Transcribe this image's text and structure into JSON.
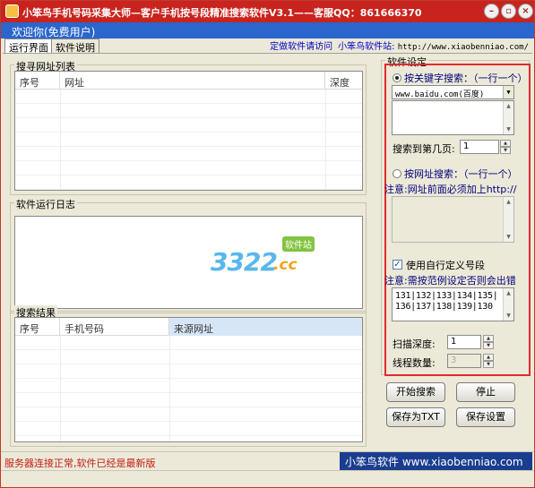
{
  "window": {
    "title": "小笨鸟手机号码采集大师—客户手机按号段精准搜索软件V3.1——客服QQ：861666370",
    "controls": [
      "minimize-icon",
      "restore-icon",
      "close-icon"
    ],
    "accent": "#c9231d"
  },
  "welcome": {
    "text": "欢迎你(免费用户)"
  },
  "tabs": [
    {
      "label": "运行界面",
      "active": true
    },
    {
      "label": "软件说明",
      "active": false
    }
  ],
  "links": {
    "custom": "定做软件请访问",
    "site_label": "小笨鸟软件站:",
    "site_url": "http://www.xiaobenniao.com/"
  },
  "url_list": {
    "title": "搜寻网址列表",
    "columns": [
      "序号",
      "网址",
      "深度"
    ]
  },
  "log": {
    "title": "软件运行日志",
    "watermark": {
      "number": "3322",
      "suffix": ".cc",
      "tag": "软件站"
    }
  },
  "results": {
    "title": "搜索结果",
    "columns": [
      "序号",
      "手机号码",
      "来源网址"
    ]
  },
  "settings": {
    "title": "软件设定",
    "keyword_radio": {
      "label": "按关键字搜索：（一行一个）",
      "selected": true
    },
    "engine_select": "www.baidu.com(百度)",
    "keywords": "",
    "pages_label": "搜索到第几页:",
    "pages_value": "1",
    "url_radio": {
      "label": "按网址搜索：（一行一个）",
      "selected": false
    },
    "url_note": "注意:网址前面必须加上http://",
    "custom_segment": {
      "label": "使用自行定义号段",
      "checked": true
    },
    "segment_note": "注意:需按范例设定否则会出错",
    "segments": "131|132|133|134|135|\n136|137|138|139|130",
    "depth_label": "扫描深度:",
    "depth_value": "1",
    "threads_label": "线程数量:",
    "threads_value": "3"
  },
  "buttons": {
    "start": "开始搜索",
    "stop": "停止",
    "save_txt": "保存为TXT",
    "save_settings": "保存设置"
  },
  "status": {
    "message": "服务器连接正常,软件已经是最新版",
    "brand": "小笨鸟软件 www.xiaobenniao.com"
  }
}
